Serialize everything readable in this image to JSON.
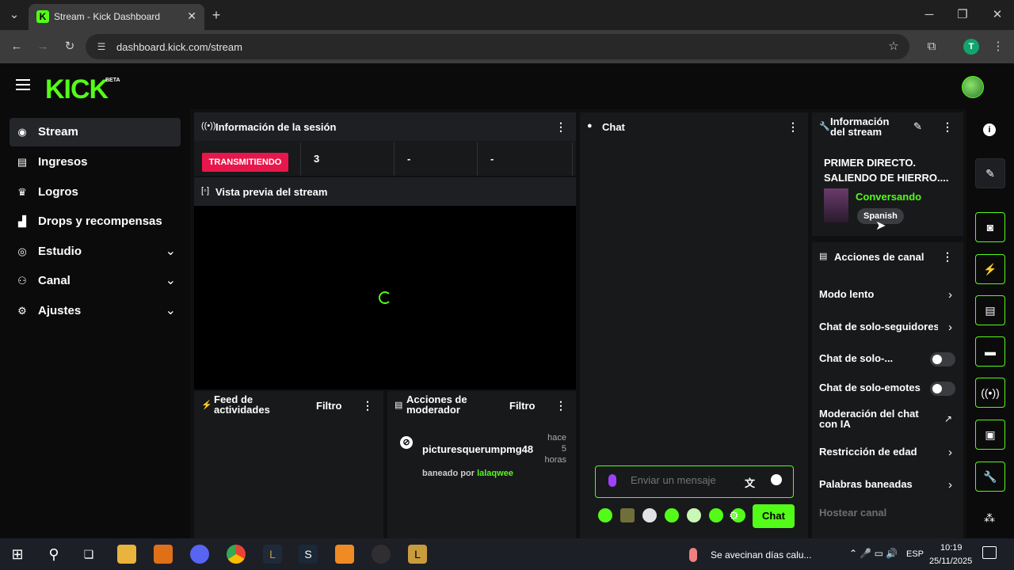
{
  "browser": {
    "tab_title": "Stream - Kick Dashboard",
    "tab_close": "✕",
    "new_tab": "+",
    "url": "dashboard.kick.com/stream",
    "profile_initial": "T",
    "window_min": "─",
    "window_max": "❐",
    "window_close": "✕"
  },
  "header": {
    "logo": "KICK",
    "beta": "BETA"
  },
  "sidebar": {
    "items": [
      {
        "label": "Stream"
      },
      {
        "label": "Ingresos"
      },
      {
        "label": "Logros"
      },
      {
        "label": "Drops y recompensas"
      },
      {
        "label": "Estudio"
      },
      {
        "label": "Canal"
      },
      {
        "label": "Ajustes"
      }
    ]
  },
  "session": {
    "title": "Información de la sesión",
    "status": "TRANSMITIENDO",
    "viewers": "3",
    "stat2": "-",
    "stat3": "-"
  },
  "preview": {
    "title": "Vista previa del stream"
  },
  "activity": {
    "title_line1": "Feed de",
    "title_line2": "actividades",
    "filter": "Filtro"
  },
  "moderator": {
    "title_line1": "Acciones de",
    "title_line2": "moderador",
    "filter": "Filtro",
    "entry": {
      "user": "picturesquerumpmg48",
      "time_line1": "hace",
      "time_line2": "5",
      "time_line3": "horas",
      "banned_by_label": "baneado por",
      "banned_by": "lalaqwee"
    }
  },
  "chat": {
    "title": "Chat",
    "placeholder": "Enviar un mensaje",
    "send_label": "Chat"
  },
  "stream_info": {
    "title_line1": "Información",
    "title_line2": "del stream",
    "stream_title_line1": "PRIMER DIRECTO.",
    "stream_title_line2": "SALIENDO DE HIERRO....",
    "category": "Conversando",
    "language": "Spanish"
  },
  "channel_actions": {
    "title": "Acciones de canal",
    "items": [
      {
        "label": "Modo lento"
      },
      {
        "label": "Chat de solo-seguidores"
      },
      {
        "label": "Chat de solo-..."
      },
      {
        "label": "Chat de solo-emotes"
      },
      {
        "label_line1": "Moderación del chat",
        "label_line2": "con IA"
      },
      {
        "label": "Restricción de edad"
      },
      {
        "label": "Palabras baneadas"
      },
      {
        "label": "Hostear canal"
      }
    ]
  },
  "taskbar": {
    "notification": "Se avecinan días calu...",
    "language": "ESP",
    "time": "10:19",
    "date": "25/11/2025"
  },
  "colors": {
    "accent": "#53fc18",
    "live": "#e8174b",
    "panel": "#18191b"
  }
}
